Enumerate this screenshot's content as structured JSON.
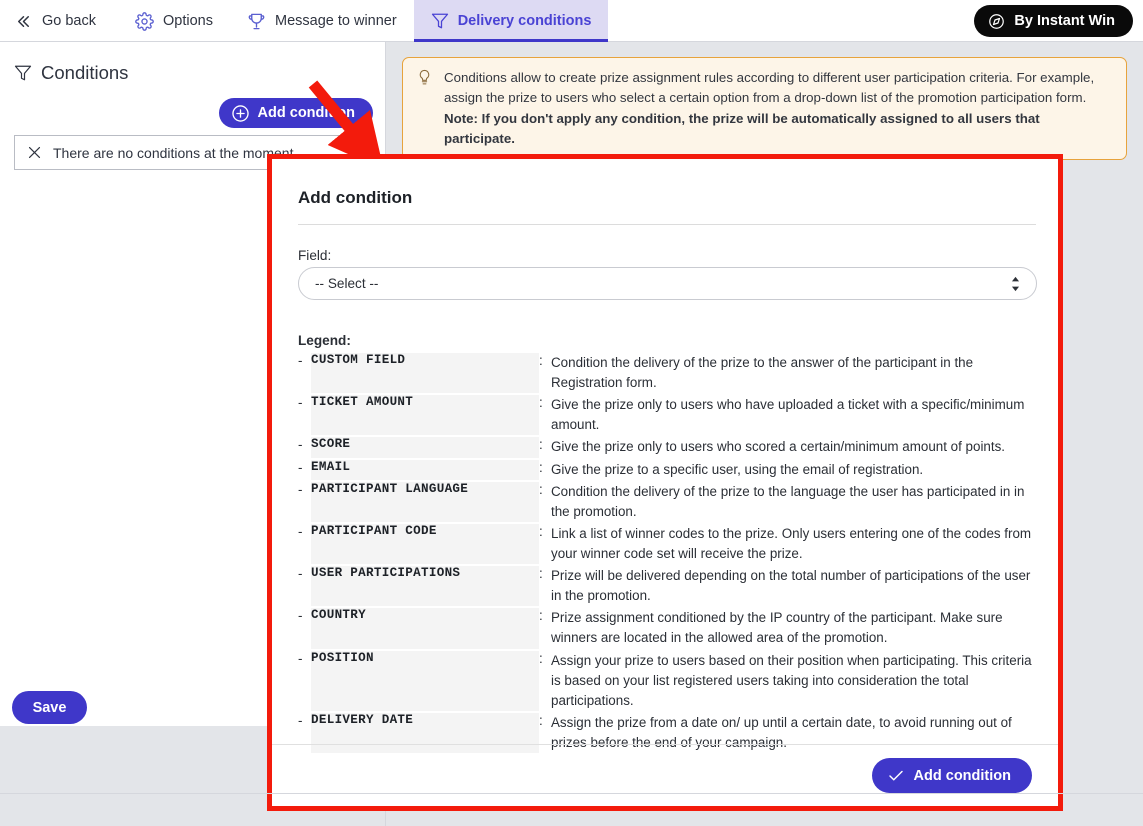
{
  "topbar": {
    "items": [
      {
        "id": "go-back",
        "label": "Go back",
        "icon": "chevrons-left-icon",
        "active": false
      },
      {
        "id": "options",
        "label": "Options",
        "icon": "gear-icon",
        "active": false
      },
      {
        "id": "message-to-winner",
        "label": "Message to winner",
        "icon": "trophy-icon",
        "active": false
      },
      {
        "id": "delivery-conditions",
        "label": "Delivery conditions",
        "icon": "filter-icon",
        "active": true
      }
    ],
    "mode_button": {
      "label": "By Instant Win",
      "icon": "compass-icon"
    }
  },
  "left_panel": {
    "heading": "Conditions",
    "heading_icon": "filter-icon",
    "add_condition_label": "Add condition",
    "add_condition_icon": "plus-circle-icon",
    "empty_state": "There are no conditions at the moment.",
    "empty_state_icon": "close-x-icon",
    "save_label": "Save"
  },
  "info_box": {
    "icon": "lightbulb-icon",
    "paragraph": "Conditions allow to create prize assignment rules according to different user participation criteria. For example, assign the prize to users who select a certain option from a drop-down list of the promotion participation form.",
    "note": "Note: If you don't apply any condition, the prize will be automatically assigned to all users that participate."
  },
  "modal": {
    "title": "Add condition",
    "field_label": "Field:",
    "select_value": "-- Select --",
    "legend_label": "Legend:",
    "legend": [
      {
        "term": "CUSTOM FIELD",
        "desc": "Condition the delivery of the prize to the answer of the participant in the Registration form."
      },
      {
        "term": "TICKET AMOUNT",
        "desc": "Give the prize only to users who have uploaded a ticket with a specific/minimum amount."
      },
      {
        "term": "SCORE",
        "desc": "Give the prize only to users who scored a certain/minimum amount of points."
      },
      {
        "term": "EMAIL",
        "desc": "Give the prize to a specific user, using the email of registration."
      },
      {
        "term": "PARTICIPANT LANGUAGE",
        "desc": "Condition the delivery of the prize to the language the user has participated in in the promotion."
      },
      {
        "term": "PARTICIPANT CODE",
        "desc": "Link a list of winner codes to the prize. Only users entering one of the codes from your winner code set will receive the prize."
      },
      {
        "term": "USER PARTICIPATIONS",
        "desc": "Prize will be delivered depending on the total number of participations of the user in the promotion."
      },
      {
        "term": "COUNTRY",
        "desc": "Prize assignment conditioned by the IP country of the participant. Make sure winners are located in the allowed area of the promotion."
      },
      {
        "term": "POSITION",
        "desc": "Assign your prize to users based on their position when participating. This criteria is based on your list registered users taking into consideration the total participations."
      },
      {
        "term": "DELIVERY DATE",
        "desc": "Assign the prize from a date on/ up until a certain date, to avoid running out of prizes before the end of your campaign."
      }
    ],
    "submit_label": "Add condition",
    "submit_icon": "check-icon"
  },
  "annotations": {
    "highlight_color": "#f31b0c",
    "arrow_color": "#f31b0c"
  },
  "colors": {
    "accent_blue": "#3f37c9",
    "active_tab_bg": "#dddaf3",
    "info_bg": "#fdf5e8",
    "info_border": "#e7a33c",
    "page_bg": "#e3e5e9",
    "legend_cell_bg": "#f4f4f4"
  }
}
